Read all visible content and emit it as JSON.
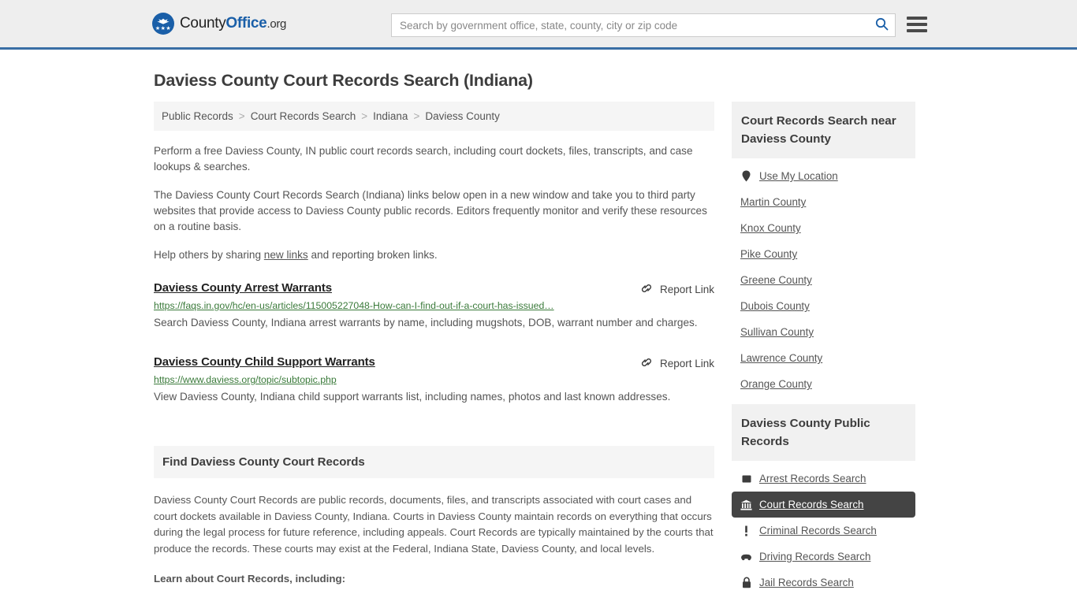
{
  "header": {
    "logo": {
      "text_part1": "County",
      "text_part2": "Office",
      "text_part3": ".org",
      "icon": "eagle-shield-icon"
    },
    "search": {
      "placeholder": "Search by government office, state, county, city or zip code",
      "value": "",
      "search_icon": "search-icon"
    },
    "menu_icon": "hamburger-menu-icon",
    "accent_color": "#3a6ea5",
    "background_color": "#eeeeee"
  },
  "page": {
    "title": "Daviess County Court Records Search (Indiana)"
  },
  "breadcrumb": {
    "separator": ">",
    "items": [
      {
        "label": "Public Records"
      },
      {
        "label": "Court Records Search"
      },
      {
        "label": "Indiana"
      },
      {
        "label": "Daviess County"
      }
    ]
  },
  "intro": {
    "paragraph1": "Perform a free Daviess County, IN public court records search, including court dockets, files, transcripts, and case lookups & searches.",
    "paragraph2": "The Daviess County Court Records Search (Indiana) links below open in a new window and take you to third party websites that provide access to Daviess County public records. Editors frequently monitor and verify these resources on a routine basis.",
    "paragraph3_before": "Help others by sharing ",
    "paragraph3_link": "new links",
    "paragraph3_after": " and reporting broken links."
  },
  "results": [
    {
      "title": "Daviess County Arrest Warrants",
      "url": "https://faqs.in.gov/hc/en-us/articles/115005227048-How-can-I-find-out-if-a-court-has-issued…",
      "description": "Search Daviess County, Indiana arrest warrants by name, including mugshots, DOB, warrant number and charges.",
      "report_label": "Report Link",
      "report_icon": "broken-link-icon"
    },
    {
      "title": "Daviess County Child Support Warrants",
      "url": "https://www.daviess.org/topic/subtopic.php",
      "description": "View Daviess County, Indiana child support warrants list, including names, photos and last known addresses.",
      "report_label": "Report Link",
      "report_icon": "broken-link-icon"
    }
  ],
  "find_section": {
    "heading": "Find Daviess County Court Records",
    "body": "Daviess County Court Records are public records, documents, files, and transcripts associated with court cases and court dockets available in Daviess County, Indiana. Courts in Daviess County maintain records on everything that occurs during the legal process for future reference, including appeals. Court Records are typically maintained by the courts that produce the records. These courts may exist at the Federal, Indiana State, Daviess County, and local levels.",
    "subheading": "Learn about Court Records, including:"
  },
  "sidebar": {
    "nearby": {
      "heading": "Court Records Search near Daviess County",
      "items": [
        {
          "label": "Use My Location",
          "icon": "map-pin-icon"
        },
        {
          "label": "Martin County",
          "icon": ""
        },
        {
          "label": "Knox County",
          "icon": ""
        },
        {
          "label": "Pike County",
          "icon": ""
        },
        {
          "label": "Greene County",
          "icon": ""
        },
        {
          "label": "Dubois County",
          "icon": ""
        },
        {
          "label": "Sullivan County",
          "icon": ""
        },
        {
          "label": "Lawrence County",
          "icon": ""
        },
        {
          "label": "Orange County",
          "icon": ""
        }
      ]
    },
    "public_records": {
      "heading": "Daviess County Public Records",
      "active_color": "#444444",
      "items": [
        {
          "label": "Arrest Records Search",
          "icon": "square-icon",
          "active": false
        },
        {
          "label": "Court Records Search",
          "icon": "courthouse-icon",
          "active": true
        },
        {
          "label": "Criminal Records Search",
          "icon": "exclamation-icon",
          "active": false
        },
        {
          "label": "Driving Records Search",
          "icon": "car-icon",
          "active": false
        },
        {
          "label": "Jail Records Search",
          "icon": "lock-icon",
          "active": false
        }
      ]
    }
  }
}
